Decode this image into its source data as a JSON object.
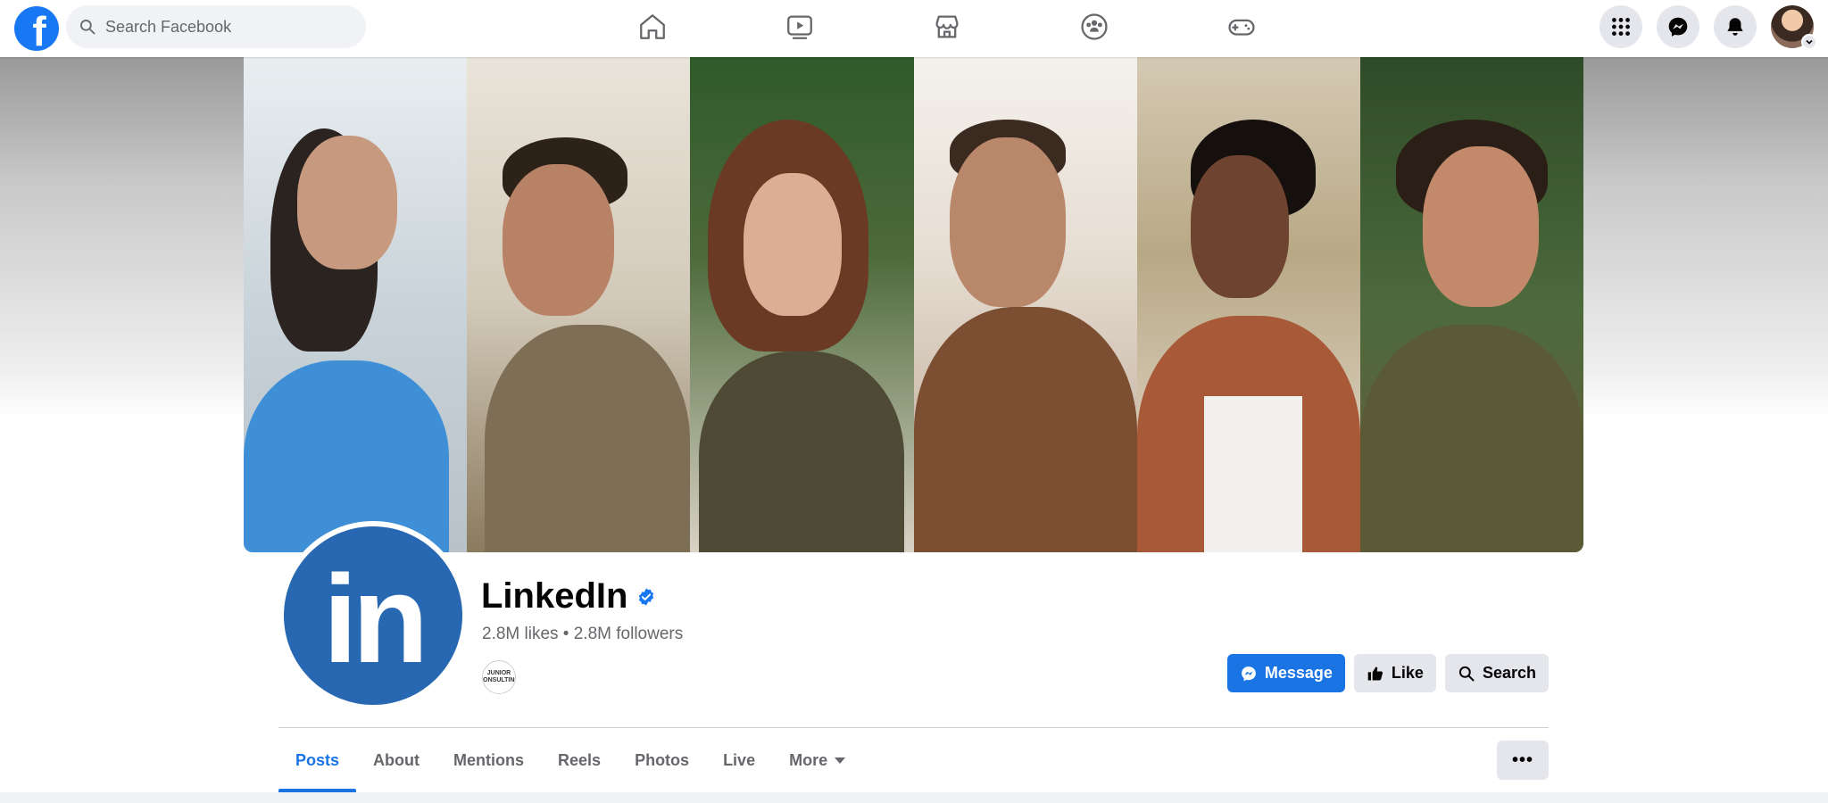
{
  "nav": {
    "logo_letter": "f",
    "search_placeholder": "Search Facebook",
    "tabs": [
      {
        "icon": "home-icon"
      },
      {
        "icon": "video-icon"
      },
      {
        "icon": "marketplace-icon"
      },
      {
        "icon": "groups-icon"
      },
      {
        "icon": "gaming-icon"
      }
    ],
    "right_icons": [
      "menu-grid-icon",
      "messenger-icon",
      "notifications-icon",
      "account-avatar"
    ]
  },
  "cover": {
    "panels": 6
  },
  "profile": {
    "logo_text": "in",
    "name": "LinkedIn",
    "verified": true,
    "stats": "2.8M likes • 2.8M followers",
    "small_avatar_text": "JUNIOR CONSULTING"
  },
  "actions": {
    "message": "Message",
    "like": "Like",
    "search": "Search"
  },
  "tabs": [
    {
      "label": "Posts",
      "active": true
    },
    {
      "label": "About",
      "active": false
    },
    {
      "label": "Mentions",
      "active": false
    },
    {
      "label": "Reels",
      "active": false
    },
    {
      "label": "Photos",
      "active": false
    },
    {
      "label": "Live",
      "active": false
    },
    {
      "label": "More",
      "active": false
    }
  ],
  "colors": {
    "facebook_blue": "#1877f2",
    "linkedin_blue": "#2867b2",
    "button_blue": "#1b74e4"
  }
}
